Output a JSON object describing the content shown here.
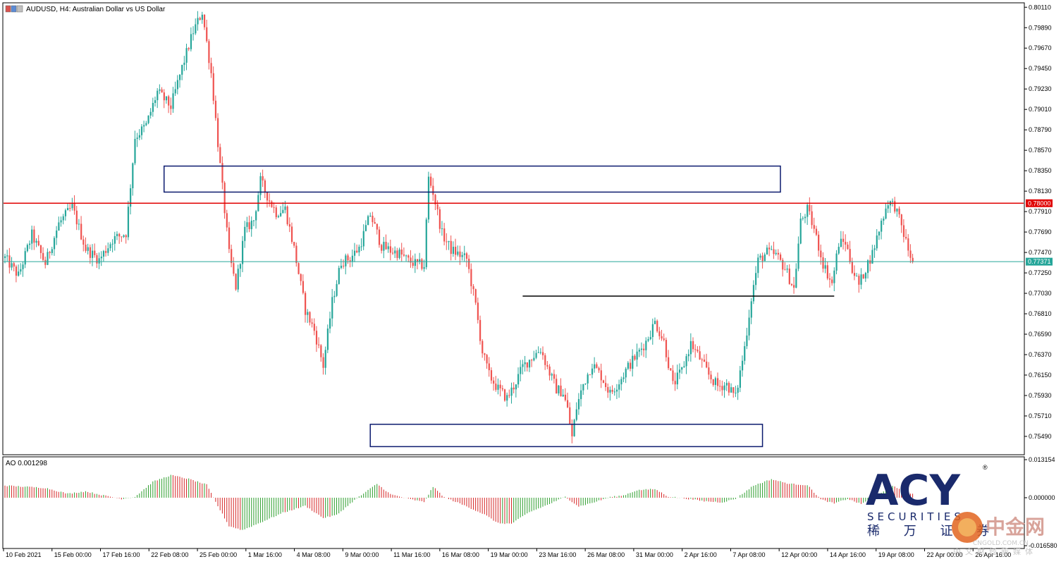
{
  "header": {
    "title": "AUDUSD, H4:  Australian Dollar vs US Dollar",
    "ao_label": "AO 0.001298"
  },
  "colors": {
    "bull": "#26a69a",
    "bear": "#ef5350",
    "resistance_line": "#e00000",
    "current_price_line": "#26a69a",
    "zone_border": "#0b1a6e",
    "support_line": "#000000",
    "ao_up": "#2e9e2e",
    "ao_down": "#d62828"
  },
  "chart_data": {
    "type": "candlestick",
    "symbol": "AUDUSD",
    "timeframe": "H4",
    "ylim": [
      0.753,
      0.8015
    ],
    "y_ticks": [
      "0.80110",
      "0.79890",
      "0.79670",
      "0.79450",
      "0.79230",
      "0.79010",
      "0.78790",
      "0.78570",
      "0.78350",
      "0.78130",
      "0.77910",
      "0.77690",
      "0.77470",
      "0.77250",
      "0.77030",
      "0.76810",
      "0.76590",
      "0.76370",
      "0.76150",
      "0.75930",
      "0.75710",
      "0.75490"
    ],
    "x_ticks": [
      "10 Feb 2021",
      "15 Feb 00:00",
      "17 Feb 16:00",
      "22 Feb 08:00",
      "25 Feb 00:00",
      "1 Mar 16:00",
      "4 Mar 08:00",
      "9 Mar 00:00",
      "11 Mar 16:00",
      "16 Mar 08:00",
      "19 Mar 00:00",
      "23 Mar 16:00",
      "26 Mar 08:00",
      "31 Mar 00:00",
      "2 Apr 16:00",
      "7 Apr 08:00",
      "12 Apr 00:00",
      "14 Apr 16:00",
      "19 Apr 08:00",
      "22 Apr 00:00",
      "26 Apr 16:00"
    ],
    "price_tags": {
      "resistance": "0.78000",
      "current": "0.77371"
    },
    "resistance_level": 0.78,
    "current_price": 0.77371,
    "support_level": 0.77,
    "path_anchors": [
      [
        0,
        0.7741
      ],
      [
        6,
        0.7722
      ],
      [
        12,
        0.7766
      ],
      [
        18,
        0.7735
      ],
      [
        24,
        0.7778
      ],
      [
        30,
        0.7796
      ],
      [
        36,
        0.7751
      ],
      [
        42,
        0.7739
      ],
      [
        48,
        0.7761
      ],
      [
        54,
        0.7768
      ],
      [
        58,
        0.7871
      ],
      [
        63,
        0.7884
      ],
      [
        68,
        0.792
      ],
      [
        74,
        0.7904
      ],
      [
        79,
        0.7946
      ],
      [
        84,
        0.7985
      ],
      [
        88,
        0.8006
      ],
      [
        92,
        0.794
      ],
      [
        96,
        0.784
      ],
      [
        100,
        0.7745
      ],
      [
        103,
        0.771
      ],
      [
        107,
        0.7771
      ],
      [
        111,
        0.7782
      ],
      [
        114,
        0.7824
      ],
      [
        118,
        0.7803
      ],
      [
        121,
        0.779
      ],
      [
        125,
        0.7794
      ],
      [
        129,
        0.7751
      ],
      [
        134,
        0.7685
      ],
      [
        138,
        0.7663
      ],
      [
        142,
        0.7625
      ],
      [
        146,
        0.7694
      ],
      [
        150,
        0.7737
      ],
      [
        154,
        0.7741
      ],
      [
        158,
        0.7752
      ],
      [
        163,
        0.7788
      ],
      [
        168,
        0.7754
      ],
      [
        172,
        0.7749
      ],
      [
        176,
        0.7746
      ],
      [
        180,
        0.7738
      ],
      [
        184,
        0.7734
      ],
      [
        187,
        0.7733
      ],
      [
        189,
        0.7827
      ],
      [
        191,
        0.7812
      ],
      [
        195,
        0.7767
      ],
      [
        199,
        0.775
      ],
      [
        203,
        0.7744
      ],
      [
        206,
        0.774
      ],
      [
        210,
        0.769
      ],
      [
        213,
        0.764
      ],
      [
        216,
        0.7615
      ],
      [
        220,
        0.76
      ],
      [
        224,
        0.759
      ],
      [
        227,
        0.7603
      ],
      [
        231,
        0.7624
      ],
      [
        235,
        0.7634
      ],
      [
        239,
        0.7643
      ],
      [
        242,
        0.7623
      ],
      [
        246,
        0.76
      ],
      [
        249,
        0.7596
      ],
      [
        251,
        0.7578
      ],
      [
        253,
        0.7548
      ],
      [
        255,
        0.758
      ],
      [
        258,
        0.7605
      ],
      [
        262,
        0.7627
      ],
      [
        266,
        0.7614
      ],
      [
        270,
        0.7595
      ],
      [
        274,
        0.7608
      ],
      [
        278,
        0.7624
      ],
      [
        282,
        0.7637
      ],
      [
        286,
        0.7651
      ],
      [
        290,
        0.7672
      ],
      [
        294,
        0.7651
      ],
      [
        298,
        0.7604
      ],
      [
        302,
        0.762
      ],
      [
        306,
        0.7649
      ],
      [
        310,
        0.7633
      ],
      [
        314,
        0.7615
      ],
      [
        318,
        0.7603
      ],
      [
        322,
        0.7605
      ],
      [
        326,
        0.7591
      ],
      [
        330,
        0.7645
      ],
      [
        333,
        0.7698
      ],
      [
        336,
        0.7738
      ],
      [
        340,
        0.7747
      ],
      [
        344,
        0.7744
      ],
      [
        348,
        0.773
      ],
      [
        352,
        0.7708
      ],
      [
        355,
        0.778
      ],
      [
        358,
        0.7793
      ],
      [
        361,
        0.7772
      ],
      [
        365,
        0.7735
      ],
      [
        369,
        0.7713
      ],
      [
        372,
        0.7757
      ],
      [
        375,
        0.7758
      ],
      [
        378,
        0.773
      ],
      [
        381,
        0.7712
      ],
      [
        384,
        0.773
      ],
      [
        387,
        0.7746
      ],
      [
        391,
        0.778
      ],
      [
        394,
        0.7802
      ],
      [
        397,
        0.7797
      ],
      [
        400,
        0.7775
      ],
      [
        403,
        0.775
      ],
      [
        405,
        0.7737
      ]
    ],
    "ao": {
      "scale_labels": [
        "0.013154",
        "0.000000",
        "-0.016580"
      ],
      "ylim": [
        -0.01658,
        0.013154
      ],
      "value": 0.001298,
      "anchors": [
        [
          0,
          0.0042
        ],
        [
          18,
          0.0034
        ],
        [
          28,
          0.0014
        ],
        [
          36,
          0.0022
        ],
        [
          44,
          0.0008
        ],
        [
          52,
          -0.0004
        ],
        [
          58,
          0.0003
        ],
        [
          66,
          0.0055
        ],
        [
          74,
          0.0078
        ],
        [
          82,
          0.0065
        ],
        [
          90,
          0.0045
        ],
        [
          94,
          -0.0015
        ],
        [
          100,
          -0.0098
        ],
        [
          106,
          -0.0112
        ],
        [
          114,
          -0.0086
        ],
        [
          124,
          -0.0052
        ],
        [
          134,
          -0.0028
        ],
        [
          142,
          -0.007
        ],
        [
          148,
          -0.006
        ],
        [
          156,
          -0.0008
        ],
        [
          166,
          0.0048
        ],
        [
          172,
          0.0012
        ],
        [
          180,
          -0.0004
        ],
        [
          187,
          -0.0015
        ],
        [
          191,
          0.0038
        ],
        [
          196,
          0.0002
        ],
        [
          206,
          -0.003
        ],
        [
          214,
          -0.0058
        ],
        [
          220,
          -0.0088
        ],
        [
          226,
          -0.009
        ],
        [
          234,
          -0.005
        ],
        [
          242,
          -0.0025
        ],
        [
          250,
          0.0003
        ],
        [
          256,
          -0.003
        ],
        [
          262,
          -0.0018
        ],
        [
          270,
          0.0002
        ],
        [
          276,
          0.0008
        ],
        [
          282,
          0.0026
        ],
        [
          290,
          0.003
        ],
        [
          296,
          0.0004
        ],
        [
          304,
          -0.0003
        ],
        [
          312,
          -0.0012
        ],
        [
          320,
          -0.0016
        ],
        [
          326,
          -0.0004
        ],
        [
          334,
          0.0042
        ],
        [
          342,
          0.0064
        ],
        [
          350,
          0.0048
        ],
        [
          358,
          0.0044
        ],
        [
          364,
          -0.0006
        ],
        [
          370,
          -0.002
        ],
        [
          376,
          -0.0004
        ],
        [
          382,
          -0.0022
        ],
        [
          388,
          0.0006
        ],
        [
          396,
          0.004
        ],
        [
          402,
          0.0022
        ],
        [
          405,
          0.0013
        ]
      ]
    },
    "zones": [
      {
        "name": "upper-resistance-zone",
        "y_range": [
          0.7812,
          0.784
        ],
        "x_range_bars": [
          71,
          346
        ]
      },
      {
        "name": "lower-support-zone",
        "y_range": [
          0.7538,
          0.7562
        ],
        "x_range_bars": [
          163,
          338
        ]
      }
    ],
    "support_segment_bars": [
      231,
      370
    ]
  },
  "logo": {
    "brand": "ACY",
    "registered": "®",
    "tagline": "SECURITIES",
    "cn_name": "稀 万 证 券"
  },
  "watermark": {
    "cn": "中金网",
    "en": "CNGOLD.COM.CN",
    "cn_sub": "中文财经新媒体"
  }
}
